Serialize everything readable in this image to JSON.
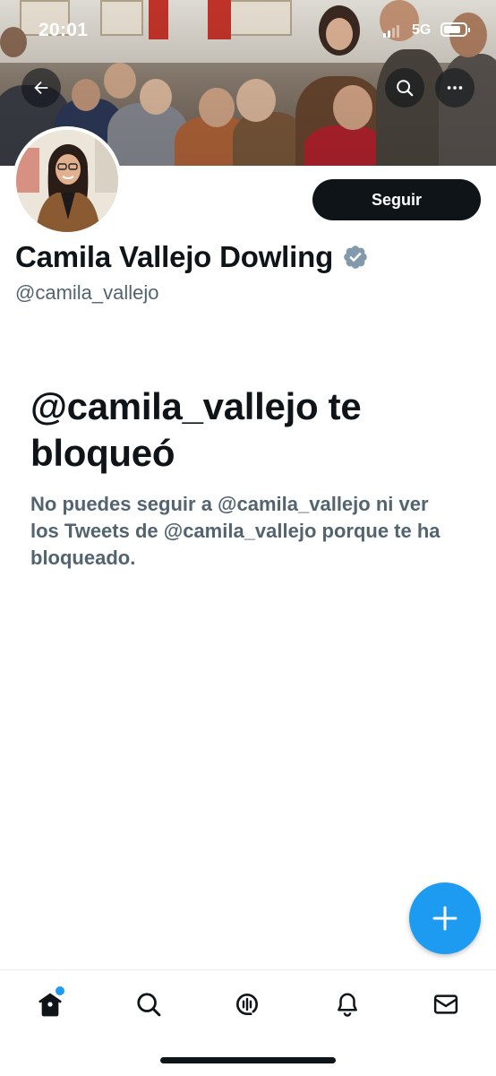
{
  "status_bar": {
    "time": "20:01",
    "network": "5G"
  },
  "header": {
    "back_icon": "arrow-left-icon",
    "search_icon": "search-icon",
    "more_icon": "more-horizontal-icon"
  },
  "profile": {
    "name": "Camila Vallejo Dowling",
    "handle": "@camila_vallejo",
    "verified_icon": "verified-badge-icon",
    "follow_label": "Seguir"
  },
  "blocked": {
    "title": "@camila_vallejo te bloqueó",
    "description": "No puedes seguir a @camila_vallejo ni ver los Tweets de @camila_vallejo porque te ha bloqueado."
  },
  "fab": {
    "icon": "plus-icon"
  },
  "bottom_nav": {
    "items": [
      {
        "icon": "home-icon",
        "active": true,
        "badge": true
      },
      {
        "icon": "search-icon",
        "active": false
      },
      {
        "icon": "spaces-icon",
        "active": false
      },
      {
        "icon": "bell-icon",
        "active": false
      },
      {
        "icon": "mail-icon",
        "active": false
      }
    ]
  },
  "colors": {
    "accent": "#1d9bf0",
    "text_primary": "#0f1419",
    "text_secondary": "#536471",
    "verified": "#829aab"
  }
}
